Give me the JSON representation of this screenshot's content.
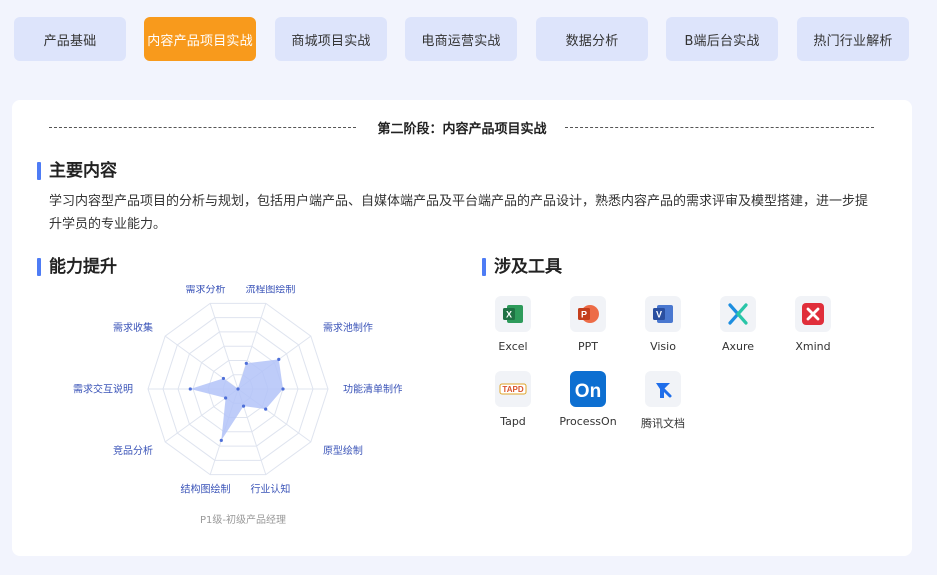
{
  "tabs": [
    {
      "label": "产品基础",
      "active": false
    },
    {
      "label": "内容产品项目实战",
      "active": true
    },
    {
      "label": "商城项目实战",
      "active": false
    },
    {
      "label": "电商运营实战",
      "active": false
    },
    {
      "label": "数据分析",
      "active": false
    },
    {
      "label": "B端后台实战",
      "active": false
    },
    {
      "label": "热门行业解析",
      "active": false
    }
  ],
  "stage_title": "第二阶段：内容产品项目实战",
  "main_content": {
    "title": "主要内容",
    "description": "学习内容型产品项目的分析与规划，包括用户端产品、自媒体端产品及平台端产品的产品设计，熟悉内容产品的需求评审及模型搭建，进一步提升学员的专业能力。"
  },
  "ability": {
    "title": "能力提升",
    "caption": "P1级-初级产品经理",
    "colors": {
      "fill": "#b3c3f8",
      "point": "#4e6fd8",
      "grid": "#dfe4ef",
      "label": "#3b54b8"
    },
    "axes": [
      {
        "label": "需求分析",
        "value": 0.0
      },
      {
        "label": "流程图绘制",
        "value": 0.3
      },
      {
        "label": "需求池制作",
        "value": 0.56
      },
      {
        "label": "功能清单制作",
        "value": 0.5
      },
      {
        "label": "原型绘制",
        "value": 0.38
      },
      {
        "label": "行业认知",
        "value": 0.2
      },
      {
        "label": "结构图绘制",
        "value": 0.6
      },
      {
        "label": "竞品分析",
        "value": 0.17
      },
      {
        "label": "需求交互说明",
        "value": 0.53
      },
      {
        "label": "需求收集",
        "value": 0.2
      }
    ]
  },
  "tools": {
    "title": "涉及工具",
    "items": [
      {
        "name": "Excel",
        "icon": "excel-icon",
        "color": "#1f7244"
      },
      {
        "name": "PPT",
        "icon": "ppt-icon",
        "color": "#d24726"
      },
      {
        "name": "Visio",
        "icon": "visio-icon",
        "color": "#3955a3"
      },
      {
        "name": "Axure",
        "icon": "axure-icon",
        "color": "#1d8ee0"
      },
      {
        "name": "Xmind",
        "icon": "xmind-icon",
        "color": "#e02f3b"
      },
      {
        "name": "Tapd",
        "icon": "tapd-icon",
        "color": "#e0a42a"
      },
      {
        "name": "ProcessOn",
        "icon": "processon-icon",
        "color": "#0d6fd1"
      },
      {
        "name": "腾讯文档",
        "icon": "tencent-docs-icon",
        "color": "#1f6eea"
      }
    ]
  }
}
